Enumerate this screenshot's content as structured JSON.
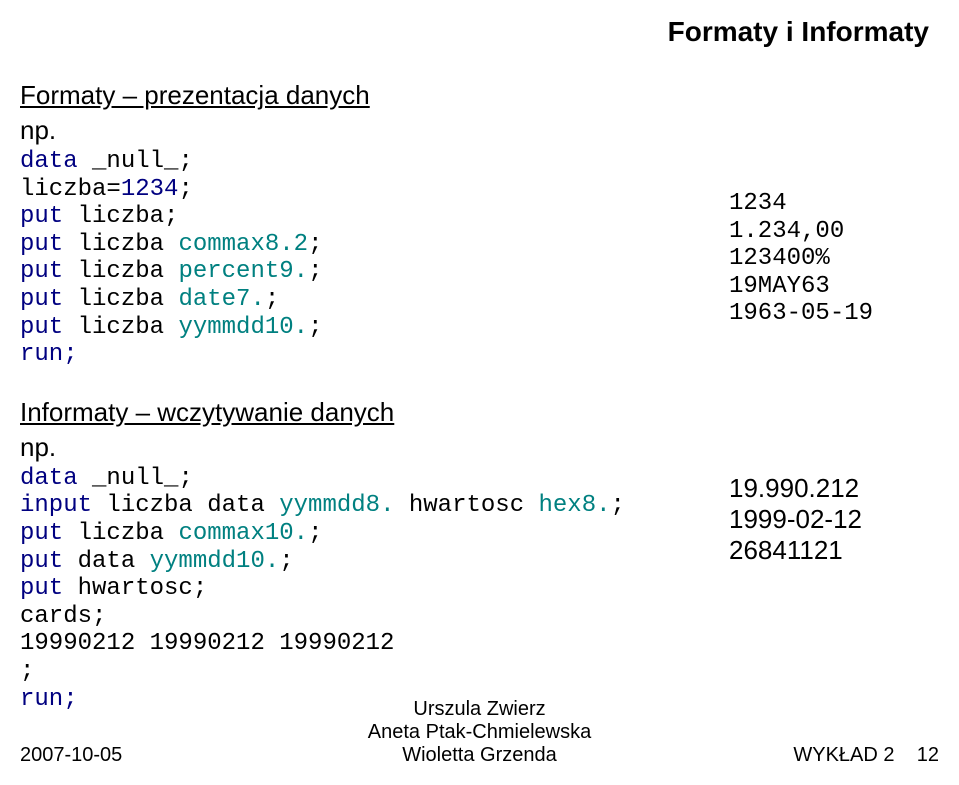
{
  "title": "Formaty i Informaty",
  "section1": {
    "header": "Formaty – prezentacja danych",
    "np": "np.",
    "code": {
      "l1a": "data ",
      "l1b": "_null_",
      "l1c": ";",
      "l2a": "liczba=",
      "l2b": "1234",
      "l2c": ";",
      "l3a": "put ",
      "l3b": "liczba;",
      "l4a": "put ",
      "l4b": "liczba ",
      "l4c": "commax8.2",
      "l4d": ";",
      "l5a": "put ",
      "l5b": "liczba ",
      "l5c": "percent9.",
      "l5d": ";",
      "l6a": "put ",
      "l6b": "liczba ",
      "l6c": "date7.",
      "l6d": ";",
      "l7a": "put ",
      "l7b": "liczba ",
      "l7c": "yymmdd10.",
      "l7d": ";",
      "l8": "run;"
    }
  },
  "output1": {
    "l1": "1234",
    "l2": "1.234,00",
    "l3": "123400%",
    "l4": "19MAY63",
    "l5": "1963-05-19"
  },
  "section2": {
    "header": "Informaty – wczytywanie danych",
    "np": "np.",
    "code": {
      "l1a": "data ",
      "l1b": "_null_",
      "l1c": ";",
      "l2a": "input ",
      "l2b": "liczba data ",
      "l2c": "yymmdd8.",
      "l2d": " hwartosc ",
      "l2e": "hex8.",
      "l2f": ";",
      "l3a": "put ",
      "l3b": "liczba ",
      "l3c": "commax10.",
      "l3d": ";",
      "l4a": "put ",
      "l4b": "data ",
      "l4c": "yymmdd10.",
      "l4d": ";",
      "l5a": "put ",
      "l5b": "hwartosc;",
      "l6": "cards;",
      "l7": "19990212 19990212 19990212",
      "l8": ";",
      "l9": "run;"
    }
  },
  "output2": {
    "l1": "19.990.212",
    "l2": "1999-02-12",
    "l3": "26841121"
  },
  "footer": {
    "date": "2007-10-05",
    "author1": "Urszula Zwierz",
    "author2": "Aneta Ptak-Chmielewska",
    "author3": "Wioletta Grzenda",
    "lecture": "WYKŁAD 2",
    "page": "12"
  }
}
